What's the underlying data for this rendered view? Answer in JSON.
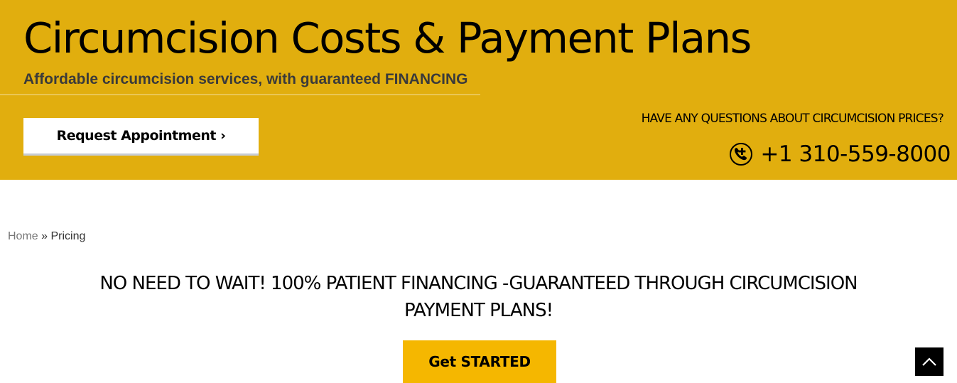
{
  "hero": {
    "title": "Circumcision Costs & Payment Plans",
    "subtitle": "Affordable circumcision services, with guaranteed FINANCING",
    "request_button_label": "Request Appointment ›",
    "questions_text": "HAVE ANY QUESTIONS ABOUT CIRCUMCISION PRICES?",
    "phone_number": "+1 310-559-8000",
    "phone_icon": "phone-plus-icon",
    "background_color": "#E1AE0E"
  },
  "breadcrumb": {
    "home_label": "Home",
    "separator": "»",
    "current_label": "Pricing"
  },
  "main": {
    "heading_line1": "NO NEED TO WAIT! 100% PATIENT FINANCING -GUARANTEED THROUGH CIRCUMCISION",
    "heading_line2": "PAYMENT PLANS!",
    "get_started_label": "Get STARTED",
    "get_started_color": "#F5B700"
  },
  "scroll_top": {
    "icon": "chevron-up-icon"
  }
}
